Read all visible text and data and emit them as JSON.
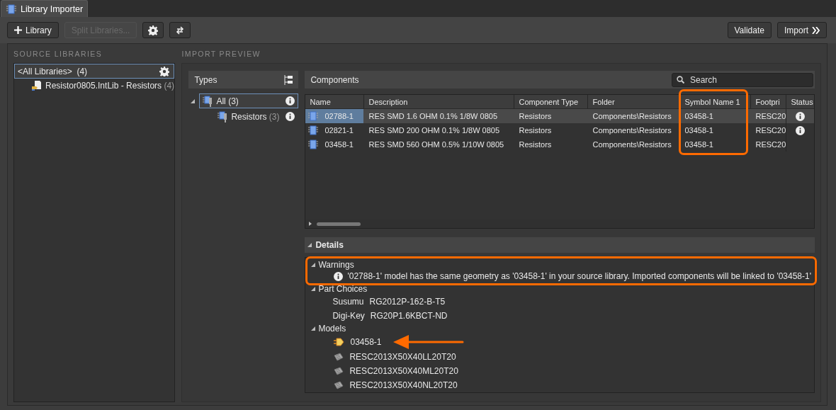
{
  "tab": {
    "label": "Library Importer",
    "selected": true
  },
  "toolbar": {
    "left": [
      {
        "kind": "add",
        "label": "Library",
        "disabled": false
      },
      {
        "kind": "text",
        "label": "Split Libraries...",
        "disabled": true
      },
      {
        "kind": "gear"
      },
      {
        "kind": "sync"
      }
    ],
    "right": [
      {
        "kind": "text",
        "label": "Validate"
      },
      {
        "kind": "forward",
        "label": "Import"
      }
    ]
  },
  "source_libraries": {
    "heading": "SOURCE LIBRARIES",
    "items": [
      {
        "label": "<All Libraries>",
        "count": "(4)",
        "selected": true,
        "children": [
          {
            "label": "Resistor0805.IntLib - Resistors",
            "count": "(4)",
            "selected": false
          }
        ]
      }
    ]
  },
  "import_preview": {
    "heading": "IMPORT PREVIEW",
    "types": {
      "title": "Types",
      "tree": [
        {
          "label": "All",
          "count": "(3)",
          "selected": true,
          "expanded": true,
          "children": [
            {
              "label": "Resistors",
              "count": "(3)",
              "selected": false
            }
          ]
        }
      ]
    },
    "components": {
      "title": "Components",
      "search": {
        "placeholder": "Search"
      },
      "columns": [
        {
          "label": "Name"
        },
        {
          "label": "Description"
        },
        {
          "label": "Component Type"
        },
        {
          "label": "Folder"
        },
        {
          "label": "Symbol Name 1",
          "highlighted": true
        },
        {
          "label": "Footpri"
        },
        {
          "label": "Status"
        }
      ],
      "rows": [
        {
          "selected": true,
          "info": true,
          "cells": [
            "02788-1",
            "RES SMD 1.6 OHM 0.1% 1/8W 0805",
            "Resistors",
            "Components\\Resistors",
            "03458-1",
            "RESC20"
          ]
        },
        {
          "selected": false,
          "info": true,
          "cells": [
            "02821-1",
            "RES SMD 200 OHM 0.1% 1/8W 0805",
            "Resistors",
            "Components\\Resistors",
            "03458-1",
            "RESC20"
          ]
        },
        {
          "selected": false,
          "info": false,
          "cells": [
            "03458-1",
            "RES SMD 560 OHM 0.5% 1/10W 0805",
            "Resistors",
            "Components\\Resistors",
            "03458-1",
            "RESC20"
          ]
        }
      ]
    },
    "details": {
      "title": "Details",
      "expanded": true,
      "sections": [
        {
          "title": "Warnings",
          "expanded": true,
          "highlighted": true,
          "items": [
            {
              "kind": "info",
              "text": "'02788-1' model has the same geometry as '03458-1' in your source library. Imported components will be linked to '03458-1'"
            }
          ]
        },
        {
          "title": "Part Choices",
          "expanded": true,
          "items": [
            {
              "kind": "supplier",
              "supplier": "Susumu",
              "part": "RG2012P-162-B-T5"
            },
            {
              "kind": "supplier",
              "supplier": "Digi-Key",
              "part": "RG20P1.6KBCT-ND"
            }
          ]
        },
        {
          "title": "Models",
          "expanded": true,
          "items": [
            {
              "kind": "symbol",
              "text": "03458-1",
              "pointed": true
            },
            {
              "kind": "footprint",
              "text": "RESC2013X50X40LL20T20",
              "pointed": false
            },
            {
              "kind": "footprint",
              "text": "RESC2013X50X40ML20T20",
              "pointed": false
            },
            {
              "kind": "footprint",
              "text": "RESC2013X50X40NL20T20",
              "pointed": false
            }
          ]
        }
      ]
    }
  }
}
